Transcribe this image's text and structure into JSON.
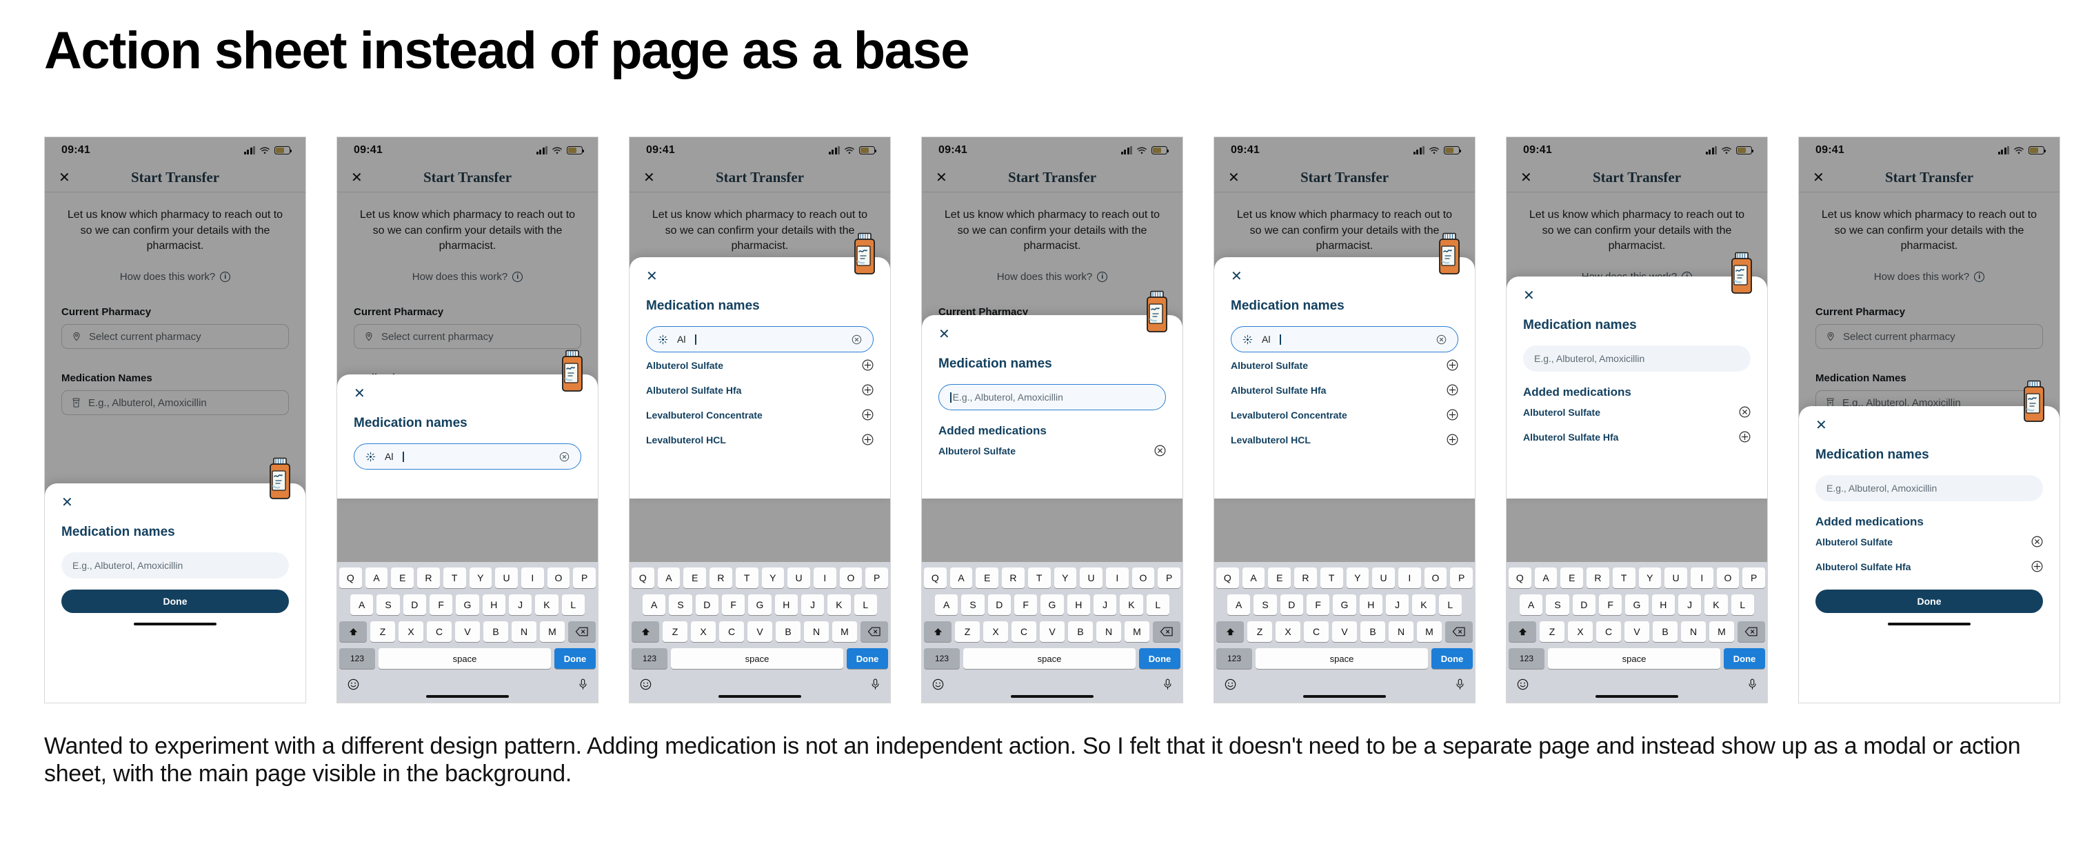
{
  "page_title": "Action sheet instead of page as a base",
  "caption": "Wanted to experiment with a different design pattern. Adding medication is not an independent action. So I felt that it doesn't need to be a separate page and instead show up as a modal or action sheet, with the main page visible in the background.",
  "colors": {
    "brand_navy": "#13405f",
    "accent_blue": "#2b7fd4",
    "keyboard_done": "#1c7ed6",
    "bottle_orange": "#e0803c",
    "battery_yellow": "#e3a70a",
    "dim_overlay": "#808080"
  },
  "status_bar": {
    "time": "09:41",
    "signal_icon": "cellular-signal-icon",
    "wifi_icon": "wifi-icon",
    "battery_icon": "battery-low-power-icon"
  },
  "base_page": {
    "close_label": "✕",
    "title": "Start Transfer",
    "lede": "Let us know which pharmacy to reach out to so we can confirm your details with the pharmacist.",
    "how_link": "How does this work?",
    "info_icon": "info-circle-icon",
    "current_pharmacy_label": "Current Pharmacy",
    "current_pharmacy_placeholder": "Select current pharmacy",
    "pharmacy_icon": "location-pin-icon",
    "medication_names_label": "Medication Names",
    "medication_names_placeholder": "E.g., Albuterol, Amoxicillin",
    "medication_icon": "prescription-bottle-icon"
  },
  "sheet": {
    "close_label": "✕",
    "heading": "Medication names",
    "input_placeholder": "E.g., Albuterol, Amoxicillin",
    "input_value": "Al",
    "sparkle_icon": "ai-sparkle-icon",
    "clear_icon": "clear-circle-icon",
    "added_heading": "Added medications",
    "done_label": "Done",
    "bottle_icon": "pill-bottle-sticker-icon"
  },
  "search_results": [
    {
      "match": "Al",
      "rest": "buterol Sulfate",
      "action_icon": "add-circle-icon"
    },
    {
      "match": "Al",
      "rest": "buterol Sulfate Hfa",
      "action_icon": "add-circle-icon"
    },
    {
      "match": "",
      "rest": "Levalbuterol Concentrate",
      "action_icon": "add-circle-icon"
    },
    {
      "match": "",
      "rest": "Levalbuterol HCL",
      "action_icon": "add-circle-icon"
    }
  ],
  "added_one": [
    {
      "label": "Albuterol Sulfate",
      "action_icon": "remove-circle-icon"
    }
  ],
  "added_two": [
    {
      "label": "Albuterol Sulfate",
      "action_icon": "remove-circle-icon"
    },
    {
      "label": "Albuterol Sulfate Hfa",
      "action_icon": "add-circle-icon"
    }
  ],
  "keyboard": {
    "row1": [
      "Q",
      "A",
      "E",
      "R",
      "T",
      "Y",
      "U",
      "I",
      "O",
      "P"
    ],
    "row2": [
      "A",
      "S",
      "D",
      "F",
      "G",
      "H",
      "J",
      "K",
      "L"
    ],
    "row3": [
      "Z",
      "X",
      "C",
      "V",
      "B",
      "N",
      "M"
    ],
    "shift_icon": "shift-arrow-icon",
    "backspace_icon": "backspace-icon",
    "numbers_label": "123",
    "space_label": "space",
    "done_label": "Done",
    "emoji_icon": "emoji-smiley-icon",
    "mic_icon": "microphone-icon"
  },
  "frames": [
    {
      "name": "frame-1-sheet-resting"
    },
    {
      "name": "frame-2-sheet-typing"
    },
    {
      "name": "frame-3-sheet-results"
    },
    {
      "name": "frame-4-sheet-added-one"
    },
    {
      "name": "frame-5-sheet-results"
    },
    {
      "name": "frame-6-sheet-added-two"
    },
    {
      "name": "frame-7-sheet-final"
    }
  ]
}
